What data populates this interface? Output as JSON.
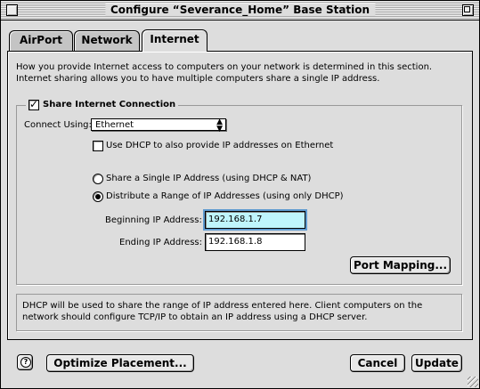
{
  "window": {
    "title": "Configure “Severance_Home” Base Station"
  },
  "tabs": [
    {
      "label": "AirPort"
    },
    {
      "label": "Network"
    },
    {
      "label": "Internet"
    }
  ],
  "internet": {
    "description": "How you provide Internet access to computers on your network is determined in this section. Internet sharing allows you to have multiple computers share a single IP address.",
    "share_checkbox_label": "Share Internet Connection",
    "share_checked": true,
    "connect_using_label": "Connect Using:",
    "connect_using_value": "Ethernet",
    "dhcp_ethernet_label": "Use DHCP to also provide IP addresses on Ethernet",
    "dhcp_ethernet_checked": false,
    "radio_single_label": "Share a Single IP Address (using DHCP & NAT)",
    "radio_range_label": "Distribute a Range of IP Addresses (using only DHCP)",
    "selected_radio": "range",
    "beginning_ip_label": "Beginning IP Address:",
    "beginning_ip_value": "192.168.1.7",
    "ending_ip_label": "Ending IP Address:",
    "ending_ip_value": "192.168.1.8",
    "port_mapping_label": "Port Mapping...",
    "info_text": "DHCP will be used to share the range of IP address entered here. Client computers on the network should configure TCP/IP to obtain an IP address using a DHCP server."
  },
  "footer": {
    "help_icon": "question-mark-icon",
    "optimize_label": "Optimize Placement...",
    "cancel_label": "Cancel",
    "update_label": "Update"
  }
}
